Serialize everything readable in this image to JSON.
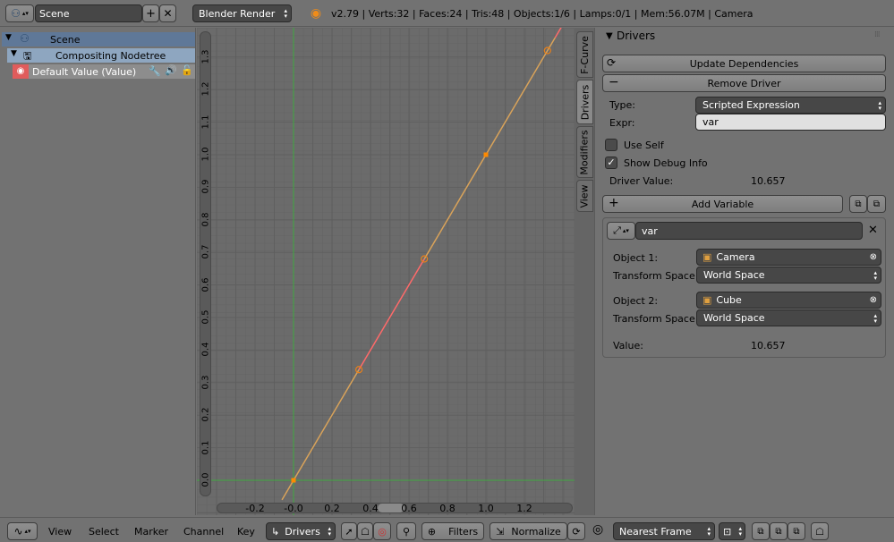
{
  "header": {
    "scene_name": "Scene",
    "render_engine": "Blender Render",
    "stats": "v2.79 | Verts:32 | Faces:24 | Tris:48 | Objects:1/6 | Lamps:0/1 | Mem:56.07M | Camera"
  },
  "outliner": {
    "items": [
      {
        "label": "Scene"
      },
      {
        "label": "Compositing Nodetree"
      },
      {
        "label": "Default Value (Value)"
      }
    ]
  },
  "graph": {
    "y_ticks": [
      "1.3",
      "1.2",
      "1.1",
      "1.0",
      "0.9",
      "0.8",
      "0.7",
      "0.6",
      "0.5",
      "0.4",
      "0.3",
      "0.2",
      "0.1",
      "0.0"
    ],
    "x_ticks": [
      "-0.2",
      "-0.0",
      "0.2",
      "0.4",
      "0.6",
      "0.8",
      "1.0",
      "1.2"
    ],
    "curve_color": "#d9a35a",
    "active_segment_color": "#ff6a6a",
    "cursor_color": "#3fa83f"
  },
  "tabs": [
    {
      "label": "F-Curve",
      "active": false
    },
    {
      "label": "Drivers",
      "active": true
    },
    {
      "label": "Modifiers",
      "active": false
    },
    {
      "label": "View",
      "active": false
    }
  ],
  "drivers": {
    "panel_title": "Drivers",
    "update_dependencies": "Update Dependencies",
    "remove_driver": "Remove Driver",
    "type_label": "Type:",
    "type_value": "Scripted Expression",
    "expr_label": "Expr:",
    "expr_value": "var",
    "use_self_label": "Use Self",
    "use_self_checked": false,
    "show_debug_label": "Show Debug Info",
    "show_debug_checked": true,
    "driver_value_label": "Driver Value:",
    "driver_value": "10.657",
    "add_variable": "Add Variable",
    "variable": {
      "name": "var",
      "object1_label": "Object 1:",
      "object1_value": "Camera",
      "transform_space_label": "Transform Space:",
      "transform_space1_value": "World Space",
      "object2_label": "Object 2:",
      "object2_value": "Cube",
      "transform_space2_value": "World Space",
      "value_label": "Value:",
      "value": "10.657"
    }
  },
  "bottombar": {
    "menus": [
      "View",
      "Select",
      "Marker",
      "Channel",
      "Key"
    ],
    "mode": "Drivers",
    "filters": "Filters",
    "normalize": "Normalize",
    "pivot": "Nearest Frame"
  }
}
